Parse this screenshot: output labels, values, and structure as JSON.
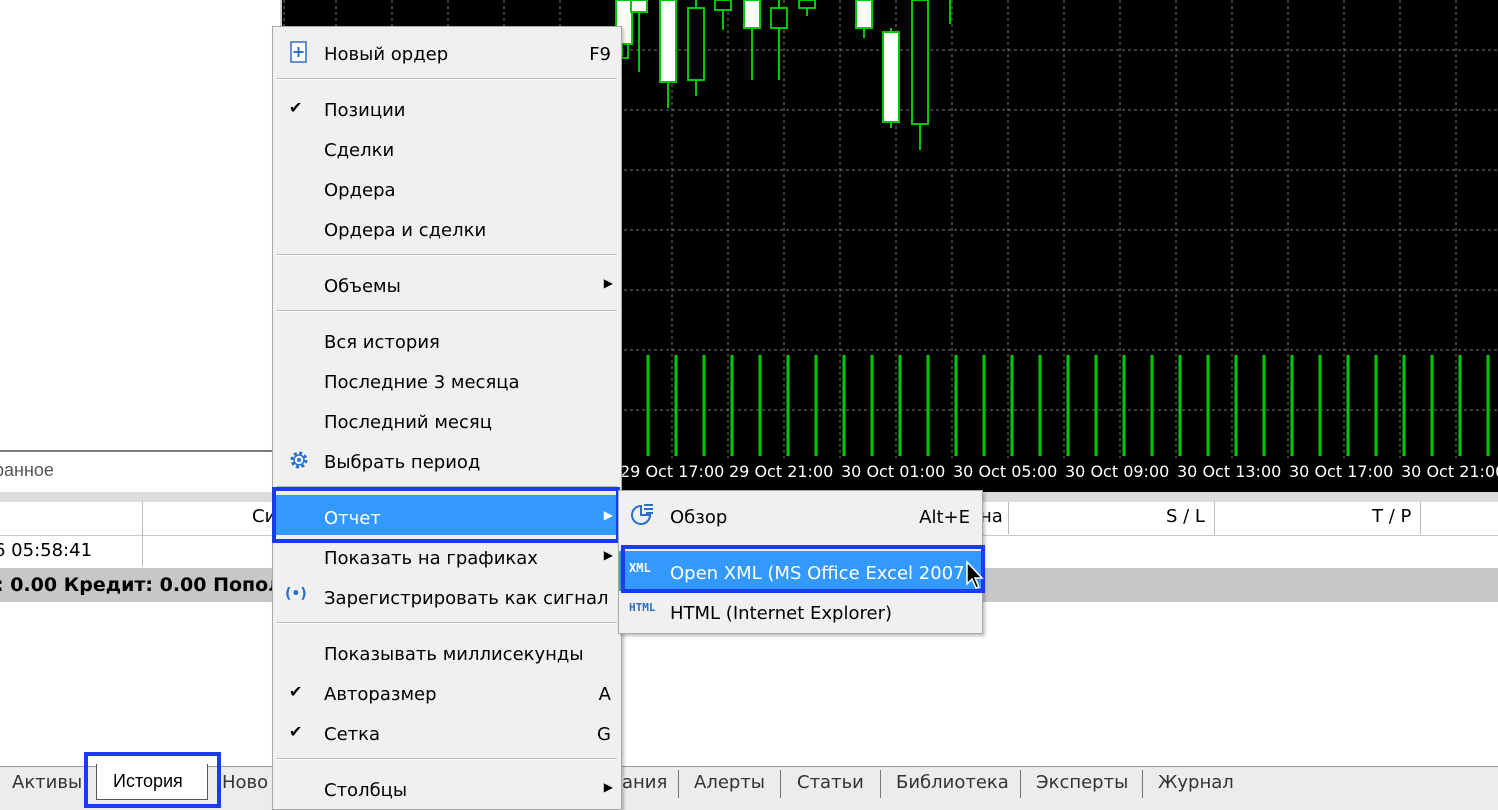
{
  "navigator": {
    "favorites_tab": "ранное"
  },
  "chart": {
    "time_labels": [
      "29 Oct 17:00",
      "29 Oct 21:00",
      "30 Oct 01:00",
      "30 Oct 05:00",
      "30 Oct 09:00",
      "30 Oct 13:00",
      "30 Oct 17:00",
      "30 Oct 21:00"
    ],
    "candle_color": "#00c800",
    "background": "#000000"
  },
  "terminal": {
    "headers": {
      "symbol_partial": "Си",
      "price_partial": "на",
      "sl": "S / L",
      "tp": "T / P"
    },
    "row_time": "6 05:58:41",
    "balance_line": ": 0.00  Кредит: 0.00  Пополн"
  },
  "tabs": [
    {
      "label": "Активы"
    },
    {
      "label": "История"
    },
    {
      "label": "Ново"
    },
    {
      "label": "ания"
    },
    {
      "label": "Алерты"
    },
    {
      "label": "Статьи"
    },
    {
      "label": "Библиотека"
    },
    {
      "label": "Эксперты"
    },
    {
      "label": "Журнал"
    }
  ],
  "context_menu": {
    "new_order": {
      "label": "Новый ордер",
      "shortcut": "F9"
    },
    "positions": {
      "label": "Позиции",
      "checked": true
    },
    "deals": {
      "label": "Сделки"
    },
    "orders": {
      "label": "Ордера"
    },
    "orders_and_deals": {
      "label": "Ордера и сделки"
    },
    "volumes": {
      "label": "Объемы"
    },
    "all_history": {
      "label": "Вся история"
    },
    "last_3_months": {
      "label": "Последние 3 месяца"
    },
    "last_month": {
      "label": "Последний месяц"
    },
    "select_period": {
      "label": "Выбрать период"
    },
    "report": {
      "label": "Отчет"
    },
    "show_on_charts": {
      "label": "Показать на графиках"
    },
    "register_signal": {
      "label": "Зарегистрировать как сигнал"
    },
    "show_ms": {
      "label": "Показывать миллисекунды"
    },
    "autosize": {
      "label": "Авторазмер",
      "shortcut": "A",
      "checked": true
    },
    "grid": {
      "label": "Сетка",
      "shortcut": "G",
      "checked": true
    },
    "columns": {
      "label": "Столбцы"
    }
  },
  "report_submenu": {
    "overview": {
      "label": "Обзор",
      "shortcut": "Alt+E"
    },
    "open_xml": {
      "label": "Open XML (MS Office Excel 2007)",
      "icon_text": "XML"
    },
    "html": {
      "label": "HTML (Internet Explorer)",
      "icon_text": "HTML"
    }
  },
  "colors": {
    "selection": "#3399ff",
    "highlight_box": "#1a3cf0",
    "menu_bg": "#f0f0f0"
  }
}
